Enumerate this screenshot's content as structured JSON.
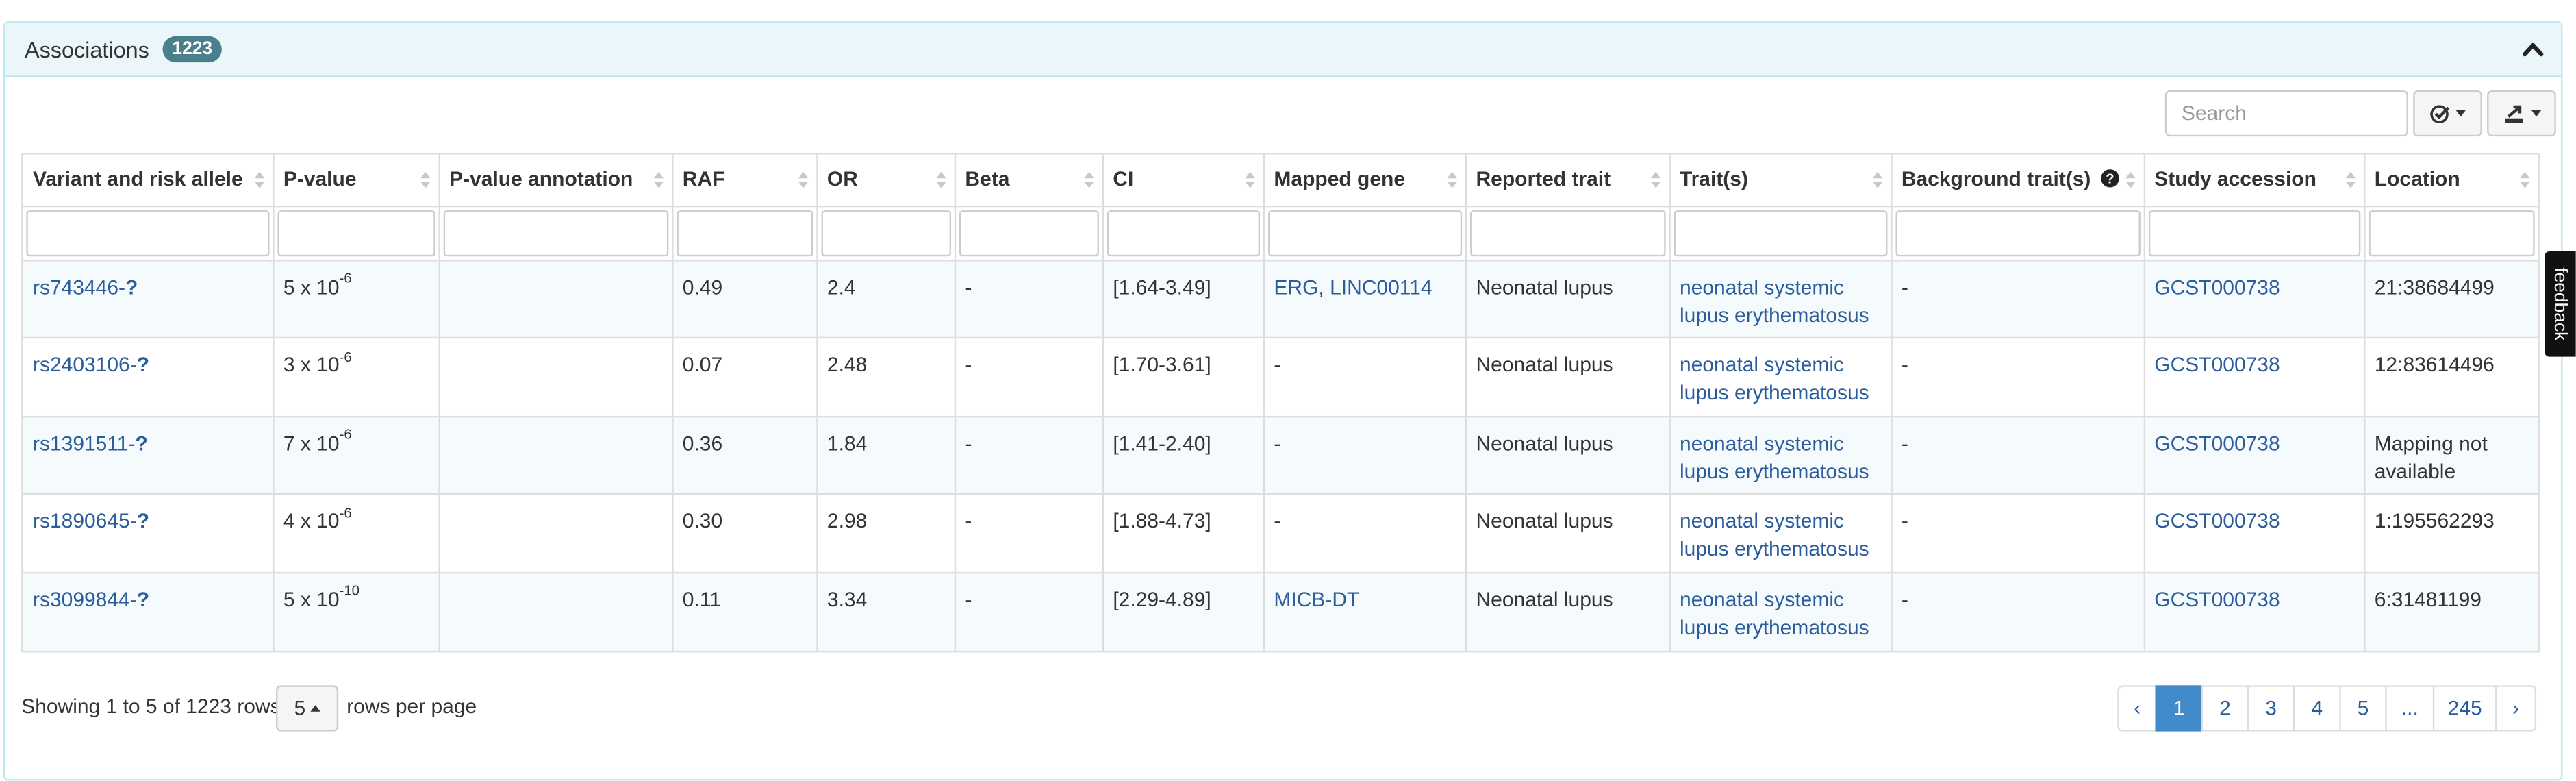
{
  "panel": {
    "title": "Associations",
    "count": "1223"
  },
  "search": {
    "placeholder": "Search"
  },
  "columns": [
    "Variant and risk allele",
    "P-value",
    "P-value annotation",
    "RAF",
    "OR",
    "Beta",
    "CI",
    "Mapped gene",
    "Reported trait",
    "Trait(s)",
    "Background trait(s)",
    "Study accession",
    "Location"
  ],
  "rows": [
    {
      "variant": "rs743446-",
      "allele": "?",
      "p_mant": "5 x 10",
      "p_exp": "-6",
      "p_annot": "",
      "raf": "0.49",
      "or": "2.4",
      "beta": "-",
      "ci": "[1.64-3.49]",
      "gene_a": "ERG",
      "gene_sep": ", ",
      "gene_b": "LINC00114",
      "reported": "Neonatal lupus",
      "trait_1": "neonatal systemic",
      "trait_2": "lupus erythematosus",
      "background": "-",
      "study": "GCST000738",
      "loc_1": "21:38684499",
      "loc_2": ""
    },
    {
      "variant": "rs2403106-",
      "allele": "?",
      "p_mant": "3 x 10",
      "p_exp": "-6",
      "p_annot": "",
      "raf": "0.07",
      "or": "2.48",
      "beta": "-",
      "ci": "[1.70-3.61]",
      "gene_text": "-",
      "reported": "Neonatal lupus",
      "trait_1": "neonatal systemic",
      "trait_2": "lupus erythematosus",
      "background": "-",
      "study": "GCST000738",
      "loc_1": "12:83614496",
      "loc_2": ""
    },
    {
      "variant": "rs1391511-",
      "allele": "?",
      "p_mant": "7 x 10",
      "p_exp": "-6",
      "p_annot": "",
      "raf": "0.36",
      "or": "1.84",
      "beta": "-",
      "ci": "[1.41-2.40]",
      "gene_text": "-",
      "reported": "Neonatal lupus",
      "trait_1": "neonatal systemic",
      "trait_2": "lupus erythematosus",
      "background": "-",
      "study": "GCST000738",
      "loc_1": "Mapping not",
      "loc_2": "available"
    },
    {
      "variant": "rs1890645-",
      "allele": "?",
      "p_mant": "4 x 10",
      "p_exp": "-6",
      "p_annot": "",
      "raf": "0.30",
      "or": "2.98",
      "beta": "-",
      "ci": "[1.88-4.73]",
      "gene_text": "-",
      "reported": "Neonatal lupus",
      "trait_1": "neonatal systemic",
      "trait_2": "lupus erythematosus",
      "background": "-",
      "study": "GCST000738",
      "loc_1": "1:195562293",
      "loc_2": ""
    },
    {
      "variant": "rs3099844-",
      "allele": "?",
      "p_mant": "5 x 10",
      "p_exp": "-10",
      "p_annot": "",
      "raf": "0.11",
      "or": "3.34",
      "beta": "-",
      "ci": "[2.29-4.89]",
      "gene_a": "MICB-DT",
      "reported": "Neonatal lupus",
      "trait_1": "neonatal systemic",
      "trait_2": "lupus erythematosus",
      "background": "-",
      "study": "GCST000738",
      "loc_1": "6:31481199",
      "loc_2": ""
    }
  ],
  "footer": {
    "showing": "Showing 1 to 5 of 1223 rows",
    "page_size": "5",
    "rows_per_page": "rows per page"
  },
  "pagination": [
    "‹",
    "1",
    "2",
    "3",
    "4",
    "5",
    "...",
    "245",
    "›"
  ],
  "active_page": "1",
  "feedback": "feedback",
  "colors": {
    "link": "#2b5d9c",
    "header_bg": "#eaf6fa",
    "badge": "#4a7f8c",
    "active_page": "#428bca"
  }
}
